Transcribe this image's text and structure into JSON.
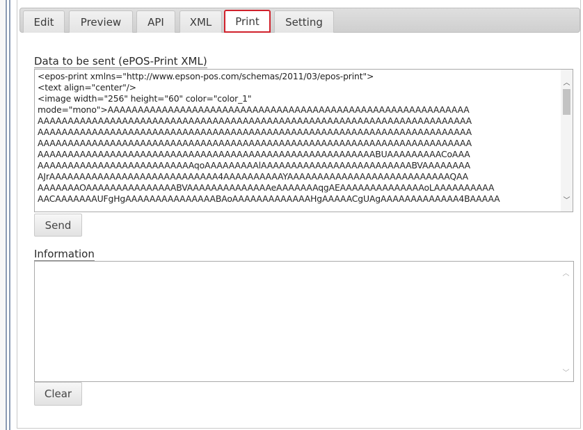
{
  "tabs": [
    {
      "label": "Edit"
    },
    {
      "label": "Preview"
    },
    {
      "label": "API"
    },
    {
      "label": "XML"
    },
    {
      "label": "Print",
      "active": true
    },
    {
      "label": "Setting"
    }
  ],
  "data_section": {
    "label": "Data to be sent (ePOS-Print XML)",
    "lines": [
      "<epos-print xmlns=\"http://www.epson-pos.com/schemas/2011/03/epos-print\">",
      "<text align=\"center\"/>",
      "<image width=\"256\" height=\"60\" color=\"color_1\"",
      "mode=\"mono\">AAAAAAAAAAAAAAAAAAAAAAAAAAAAAAAAAAAAAAAAAAAAAAAAAAAAAAAAAAAA",
      "AAAAAAAAAAAAAAAAAAAAAAAAAAAAAAAAAAAAAAAAAAAAAAAAAAAAAAAAAAAAAAAAAAAAAAAA",
      "AAAAAAAAAAAAAAAAAAAAAAAAAAAAAAAAAAAAAAAAAAAAAAAAAAAAAAAAAAAAAAAAAAAAAAAA",
      "AAAAAAAAAAAAAAAAAAAAAAAAAAAAAAAAAAAAAAAAAAAAAAAAAAAAAAAAAAAAAAAAAAAAAAAA",
      "AAAAAAAAAAAAAAAAAAAAAAAAAAAAAAAAAAAAAAAAAAAAAAAAAAAAAAAABUAAAAAAAAACoAAA",
      "AAAAAAAAAAAAAAAAAAAAAAAAAAqoAAAAAAAAAlAAAAAAAAAAAAAAAAAAAAAAAAABVAAAAAAAA",
      "AJrAAAAAAAAAAAAAAAAAAAAAAAAAAAA4AAAAAAAAAAYAAAAAAAAAAAAAAAAAAAAAAAAAAAQAA",
      "AAAAAAAOAAAAAAAAAAAAAAABVAAAAAAAAAAAAAAeAAAAAAAqgAEAAAAAAAAAAAAAAoLAAAAAAAAAA",
      "AACAAAAAAAUFgHgAAAAAAAAAAAAAAABAoAAAAAAAAAAAAAHgAAAAACgUAgAAAAAAAAAAAAA4BAAAAA"
    ],
    "send_label": "Send"
  },
  "info_section": {
    "label": "Information",
    "value": "",
    "clear_label": "Clear"
  },
  "colors": {
    "active_tab_border": "#d0212b",
    "tabbar_bg": "#d8d8d8"
  }
}
